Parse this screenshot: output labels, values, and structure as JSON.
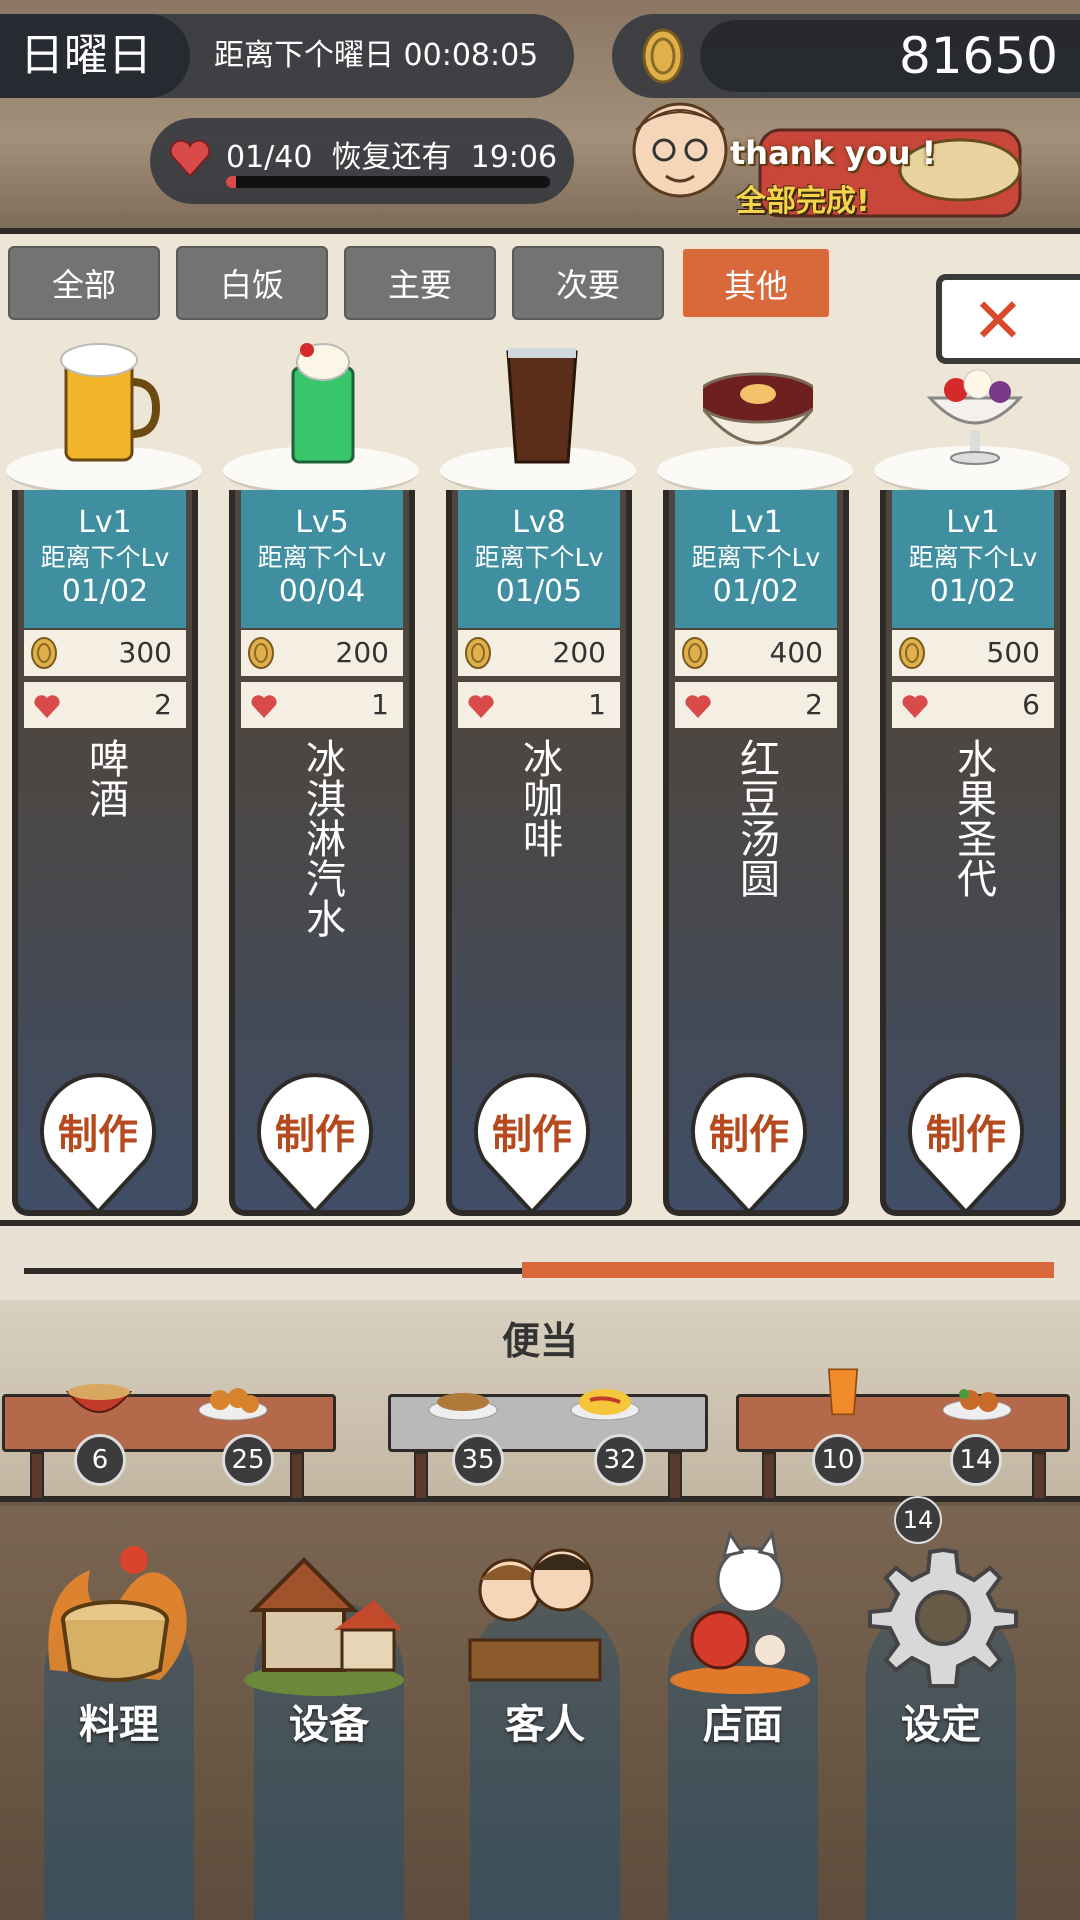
{
  "header": {
    "day_name": "日曜日",
    "day_timer": "距离下个曜日 00:08:05",
    "coins": "81650",
    "hearts": "01/40",
    "recover_label": "恢复还有",
    "recover_time": "19:06",
    "heart_progress": 0.03,
    "banner_line1": "thank you !",
    "banner_line2": "全部完成!"
  },
  "tabs": [
    {
      "label": "全部",
      "active": false
    },
    {
      "label": "白饭",
      "active": false
    },
    {
      "label": "主要",
      "active": false
    },
    {
      "label": "次要",
      "active": false
    },
    {
      "label": "其他",
      "active": true
    }
  ],
  "close_icon": "close-x-icon",
  "items": [
    {
      "name": "啤酒",
      "level": "Lv1",
      "next_label": "距离下个Lv",
      "progress": "01/02",
      "price": "300",
      "hearts": "2",
      "make": "制作",
      "icon": "beer-icon"
    },
    {
      "name": "冰淇淋汽水",
      "level": "Lv5",
      "next_label": "距离下个Lv",
      "progress": "00/04",
      "price": "200",
      "hearts": "1",
      "make": "制作",
      "icon": "cream-soda-icon"
    },
    {
      "name": "冰咖啡",
      "level": "Lv8",
      "next_label": "距离下个Lv",
      "progress": "01/05",
      "price": "200",
      "hearts": "1",
      "make": "制作",
      "icon": "iced-coffee-icon"
    },
    {
      "name": "红豆汤圆",
      "level": "Lv1",
      "next_label": "距离下个Lv",
      "progress": "01/02",
      "price": "400",
      "hearts": "2",
      "make": "制作",
      "icon": "red-bean-soup-icon"
    },
    {
      "name": "水果圣代",
      "level": "Lv1",
      "next_label": "距离下个Lv",
      "progress": "01/02",
      "price": "500",
      "hearts": "6",
      "make": "制作",
      "icon": "fruit-sundae-icon"
    }
  ],
  "scroll_progress": 0.5,
  "bento": {
    "title": "便当",
    "counts": [
      "6",
      "25",
      "35",
      "32",
      "10",
      "14"
    ]
  },
  "nav": [
    {
      "label": "料理",
      "icon": "cooking-pot-icon"
    },
    {
      "label": "设备",
      "icon": "house-icon"
    },
    {
      "label": "客人",
      "icon": "customers-icon"
    },
    {
      "label": "店面",
      "icon": "lucky-cat-icon"
    },
    {
      "label": "设定",
      "icon": "gear-icon"
    }
  ],
  "shop_badge": "14",
  "colors": {
    "accent": "#d9683a",
    "level_teal": "#3f8fa0",
    "heart": "#d94a4a",
    "make_text": "#b54a1e"
  }
}
